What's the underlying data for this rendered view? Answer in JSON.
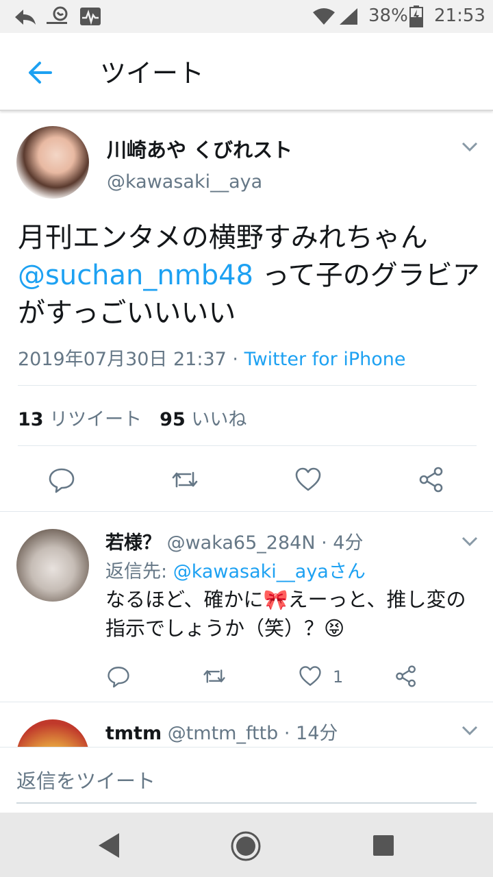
{
  "status_bar": {
    "battery": "38%",
    "time": "21:53"
  },
  "app_bar": {
    "title": "ツイート"
  },
  "tweet": {
    "author_name": "川崎あや くびれスト",
    "author_handle": "@kawasaki__aya",
    "text_before": "月刊エンタメの横野すみれちゃん",
    "mention": "@suchan_nmb48",
    "text_after": " って子のグラビアがすっごいいいい",
    "timestamp": "2019年07月30日 21:37",
    "separator": " · ",
    "source": "Twitter for iPhone",
    "retweet_count": "13",
    "retweet_label": " リツイート",
    "like_count": "95",
    "like_label": " いいね"
  },
  "replies": [
    {
      "name": "若様？",
      "handle": "@waka65_284N · 4分",
      "reply_to_label": "返信先: ",
      "reply_to": "@kawasaki__ayaさん",
      "text": "なるほど、確かに🎀えーっと、推し変の指示でしょうか（笑）？😝",
      "like_count": "1"
    },
    {
      "name": "tmtm",
      "handle": "@tmtm_fttb · 14分"
    }
  ],
  "compose": {
    "placeholder": "返信をツイート"
  },
  "colors": {
    "accent": "#1da1f2",
    "secondary_text": "#657786",
    "divider": "#e1e8ed"
  },
  "icons": [
    "back-arrow-icon",
    "reply-icon",
    "retweet-icon",
    "like-icon",
    "share-icon",
    "chevron-down-icon",
    "nav-back-icon",
    "nav-home-icon",
    "nav-recents-icon"
  ]
}
